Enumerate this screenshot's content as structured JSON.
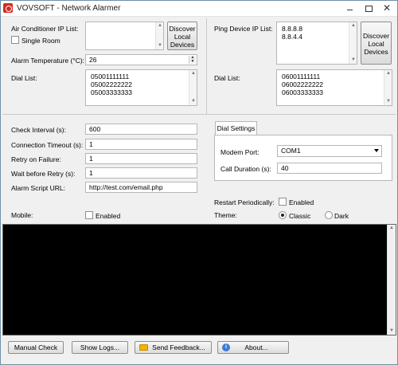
{
  "window": {
    "title": "VOVSOFT - Network Alarmer",
    "close_glyph": "✕"
  },
  "ac": {
    "ip_list_label": "Air Conditioner IP List:",
    "single_room_label": "Single Room",
    "single_room_checked": false,
    "ip_list_value": "",
    "discover_label": [
      "Discover",
      "Local",
      "Devices"
    ],
    "alarm_temp_label": "Alarm Temperature (°C):",
    "alarm_temp_value": "26",
    "dial_list_label": "Dial List:",
    "dial_list": [
      "05001111111",
      "05002222222",
      "05003333333"
    ]
  },
  "ping": {
    "ip_list_label": "Ping Device IP List:",
    "ip_list": [
      "8.8.8.8",
      "8.8.4.4"
    ],
    "discover_label": [
      "Discover",
      "Local",
      "Devices"
    ],
    "dial_list_label": "Dial List:",
    "dial_list": [
      "06001111111",
      "06002222222",
      "06003333333"
    ]
  },
  "settings": {
    "check_interval_label": "Check Interval (s):",
    "check_interval": "600",
    "connection_timeout_label": "Connection Timeout (s):",
    "connection_timeout": "1",
    "retry_label": "Retry on Failure:",
    "retry": "1",
    "wait_retry_label": "Wait before Retry (s):",
    "wait_retry": "1",
    "alarm_script_label": "Alarm Script URL:",
    "alarm_script": "http://test.com/email.php",
    "mobile_label": "Mobile:",
    "mobile_enabled_label": "Enabled",
    "mobile_enabled": false
  },
  "dial_settings": {
    "tab_label": "Dial Settings",
    "modem_port_label": "Modem Port:",
    "modem_port": "COM1",
    "call_duration_label": "Call Duration (s):",
    "call_duration": "40"
  },
  "restart": {
    "label": "Restart Periodically:",
    "enabled_label": "Enabled",
    "enabled": false
  },
  "theme": {
    "label": "Theme:",
    "options": [
      "Classic",
      "Dark"
    ],
    "selected": "Classic"
  },
  "buttons": {
    "manual_check": "Manual Check",
    "show_logs": "Show Logs...",
    "send_feedback": "Send Feedback...",
    "about": "About..."
  },
  "icons": {
    "feedback": "folder-icon",
    "about": "info-icon"
  }
}
